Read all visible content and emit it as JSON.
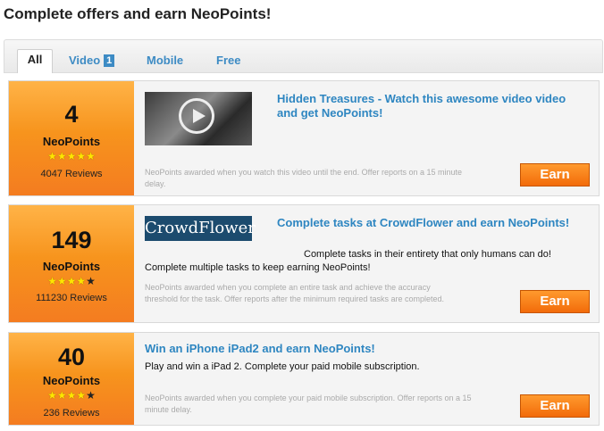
{
  "page_title": "Complete offers and earn NeoPoints!",
  "tabs": [
    {
      "label": "All"
    },
    {
      "label": "Video",
      "badge": "1"
    },
    {
      "label": "Mobile"
    },
    {
      "label": "Free"
    }
  ],
  "offers": [
    {
      "points": "4",
      "points_label": "NeoPoints",
      "stars_filled": "★★★★★",
      "stars_empty": "",
      "rating": 5,
      "reviews": "4047 Reviews",
      "title": "Hidden Treasures - Watch this awesome video video and get NeoPoints!",
      "fine_print": "NeoPoints awarded when you watch this video until the end. Offer reports on a 15 minute delay.",
      "button": "Earn"
    },
    {
      "points": "149",
      "points_label": "NeoPoints",
      "stars_filled": "★★★★",
      "stars_empty": "★",
      "rating": 4,
      "reviews": "111230 Reviews",
      "logo_text": "CrowdFlower",
      "title": "Complete tasks at CrowdFlower and earn NeoPoints!",
      "desc_line1": "Complete tasks in their entirety that only humans can do!",
      "desc_line2": "Complete multiple tasks to keep earning NeoPoints!",
      "fine_print": "NeoPoints awarded when you complete an entire task and achieve the accuracy threshold for the task. Offer reports after the minimum required tasks are completed.",
      "button": "Earn"
    },
    {
      "points": "40",
      "points_label": "NeoPoints",
      "stars_filled": "★★★★",
      "stars_empty": "★",
      "rating": 4,
      "reviews": "236 Reviews",
      "title": "Win an iPhone iPad2 and earn NeoPoints!",
      "desc": "Play and win a iPad 2. Complete your paid mobile subscription.",
      "fine_print": "NeoPoints awarded when you complete your paid mobile subscription. Offer reports on a 15 minute delay.",
      "button": "Earn"
    }
  ],
  "colors": {
    "accent_blue": "#2e86c1",
    "orange": "#f47c20",
    "button": "#f26b0a"
  }
}
